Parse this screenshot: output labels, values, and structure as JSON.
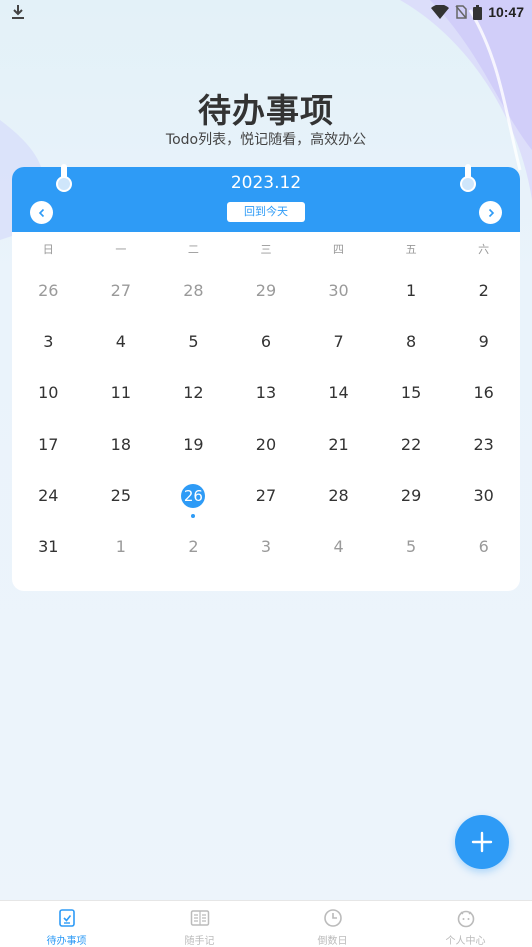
{
  "status_bar": {
    "time": "10:47"
  },
  "header": {
    "title": "待办事项",
    "subtitle": "Todo列表，悦记随看，高效办公"
  },
  "calendar": {
    "month": "2023.12",
    "today_label": "回到今天",
    "weekdays": [
      "日",
      "一",
      "二",
      "三",
      "四",
      "五",
      "六"
    ],
    "weeks": [
      [
        {
          "d": "26",
          "out": true
        },
        {
          "d": "27",
          "out": true
        },
        {
          "d": "28",
          "out": true
        },
        {
          "d": "29",
          "out": true
        },
        {
          "d": "30",
          "out": true
        },
        {
          "d": "1"
        },
        {
          "d": "2"
        }
      ],
      [
        {
          "d": "3"
        },
        {
          "d": "4"
        },
        {
          "d": "5"
        },
        {
          "d": "6"
        },
        {
          "d": "7"
        },
        {
          "d": "8"
        },
        {
          "d": "9"
        }
      ],
      [
        {
          "d": "10"
        },
        {
          "d": "11"
        },
        {
          "d": "12"
        },
        {
          "d": "13"
        },
        {
          "d": "14"
        },
        {
          "d": "15"
        },
        {
          "d": "16"
        }
      ],
      [
        {
          "d": "17"
        },
        {
          "d": "18"
        },
        {
          "d": "19"
        },
        {
          "d": "20"
        },
        {
          "d": "21"
        },
        {
          "d": "22"
        },
        {
          "d": "23"
        }
      ],
      [
        {
          "d": "24"
        },
        {
          "d": "25"
        },
        {
          "d": "26",
          "selected": true
        },
        {
          "d": "27"
        },
        {
          "d": "28"
        },
        {
          "d": "29"
        },
        {
          "d": "30"
        }
      ],
      [
        {
          "d": "31"
        },
        {
          "d": "1",
          "out": true
        },
        {
          "d": "2",
          "out": true
        },
        {
          "d": "3",
          "out": true
        },
        {
          "d": "4",
          "out": true
        },
        {
          "d": "5",
          "out": true
        },
        {
          "d": "6",
          "out": true
        }
      ]
    ]
  },
  "tabs": [
    {
      "label": "待办事项",
      "icon": "todo-icon",
      "active": true
    },
    {
      "label": "随手记",
      "icon": "notebook-icon",
      "active": false
    },
    {
      "label": "倒数日",
      "icon": "clock-icon",
      "active": false
    },
    {
      "label": "个人中心",
      "icon": "profile-icon",
      "active": false
    }
  ],
  "colors": {
    "accent": "#2e9bf6",
    "text": "#333333",
    "muted": "#9a9a9a"
  }
}
